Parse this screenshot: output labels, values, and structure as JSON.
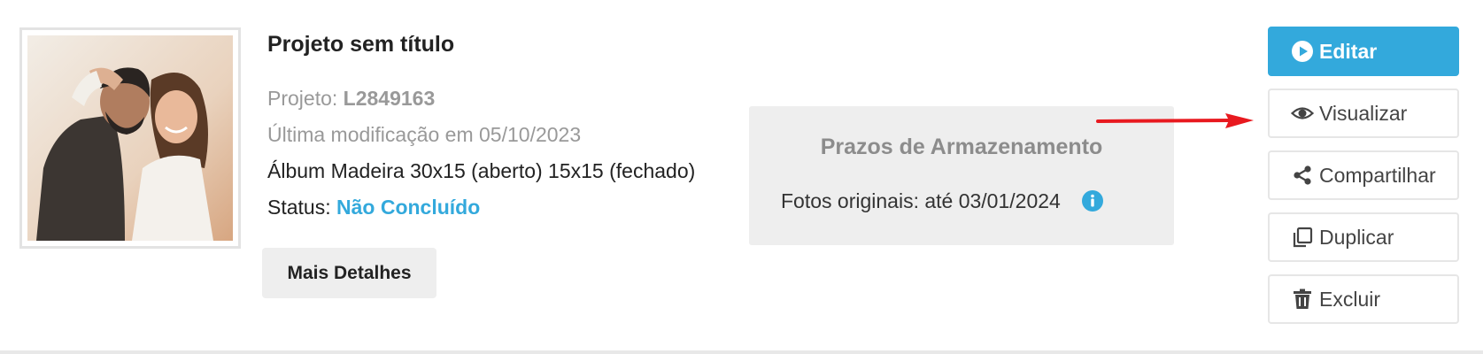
{
  "project": {
    "title": "Projeto sem título",
    "code_label": "Projeto:",
    "code_value": "L2849163",
    "modified": "Última modificação em 05/10/2023",
    "product": "Álbum Madeira 30x15 (aberto) 15x15 (fechado)",
    "status_label": "Status:",
    "status_value": "Não Concluído",
    "details_button": "Mais Detalhes"
  },
  "storage": {
    "title": "Prazos de Armazenamento",
    "originals": "Fotos originais: até 03/01/2024"
  },
  "actions": {
    "edit": "Editar",
    "view": "Visualizar",
    "share": "Compartilhar",
    "duplicate": "Duplicar",
    "delete": "Excluir"
  },
  "colors": {
    "accent": "#33a9dc",
    "annotation_arrow": "#e8191f",
    "panel": "#eeeeee"
  }
}
